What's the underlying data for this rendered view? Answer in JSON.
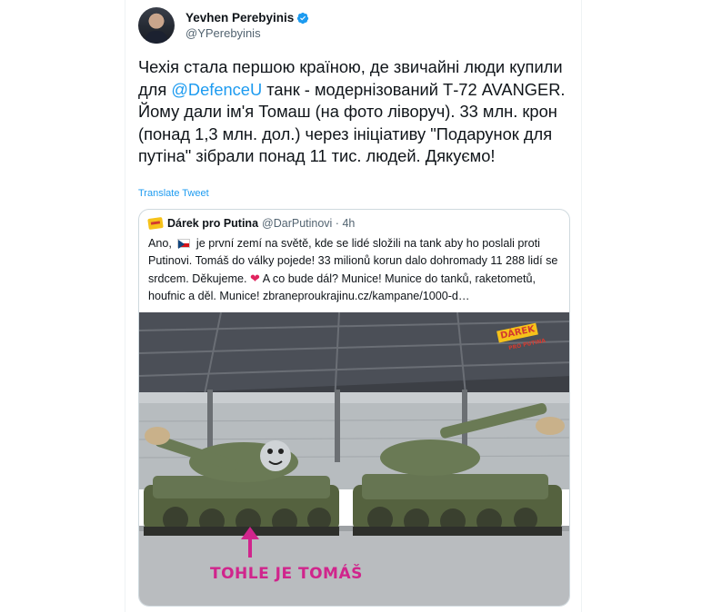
{
  "author": {
    "name": "Yevhen Perebyinis",
    "handle": "@YPerebyinis",
    "verified_icon": "verified-badge-icon"
  },
  "tweet": {
    "text_before": "Чехія стала першою країною, де звичайні люди купили для ",
    "mention": "@DefenceU",
    "text_after": " танк - модернізований Т-72 AVANGER. Йому дали ім'я Томаш (на фото ліворуч). 33 млн. крон (понад 1,3 млн. дол.) через ініціативу \"Подарунок для путіна\" зібрали понад 11 тис. людей. Дякуємо!",
    "translate_label": "Translate Tweet"
  },
  "quote": {
    "name": "Dárek pro Putina",
    "handle": "@DarPutinovi · 4h",
    "text_1": "Ano,",
    "text_2": "je první zemí na světě, kde se lidé složili na tank aby ho poslali proti Putinovi. Tomáš do války pojede! 33 milionů korun dalo dohromady 11 288 lidí se srdcem. Děkujeme.",
    "heart": "❤",
    "text_3": "A co bude dál? Munice! Munice do tanků, raketometů, houfnic a děl. Munice! zbraneproukrajinu.cz/kampane/1000-d…",
    "photo": {
      "caption": "TOHLE JE TOMÁŠ",
      "badge_main": "DÁREK",
      "badge_sub": "PRO PUTINA"
    }
  },
  "colors": {
    "accent": "#1d9bf0",
    "caption_pink": "#d0258c",
    "tank_green": "#5f6e4a"
  }
}
